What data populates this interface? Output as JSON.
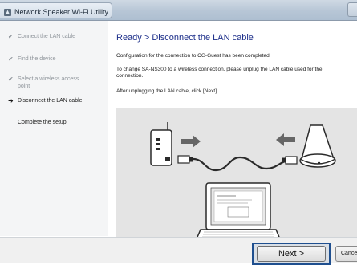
{
  "window": {
    "title": "Network Speaker Wi-Fi Utility"
  },
  "sidebar": {
    "steps": [
      {
        "label": "Connect the LAN cable",
        "state": "done",
        "mark": "✔"
      },
      {
        "label": "Find the device",
        "state": "done",
        "mark": "✔"
      },
      {
        "label": "Select a wireless access point",
        "state": "done",
        "mark": "✔"
      },
      {
        "label": "Disconnect the LAN cable",
        "state": "current",
        "mark": "➜"
      },
      {
        "label": "Complete the setup",
        "state": "pending",
        "mark": ""
      }
    ]
  },
  "main": {
    "heading": "Ready > Disconnect the LAN cable",
    "paragraphs": [
      "Configuration for the connection to CG-Guest has been completed.",
      "To change SA-NS300 to a wireless connection, please unplug the LAN cable used for the connection.",
      "After unplugging the LAN cable, click [Next]."
    ]
  },
  "footer": {
    "next_label": "Next >",
    "cancel_label": "Cancel"
  },
  "colors": {
    "heading": "#1d2f8a",
    "highlight": "#1f4f8f",
    "illustration_bg": "#e4e4e4"
  }
}
